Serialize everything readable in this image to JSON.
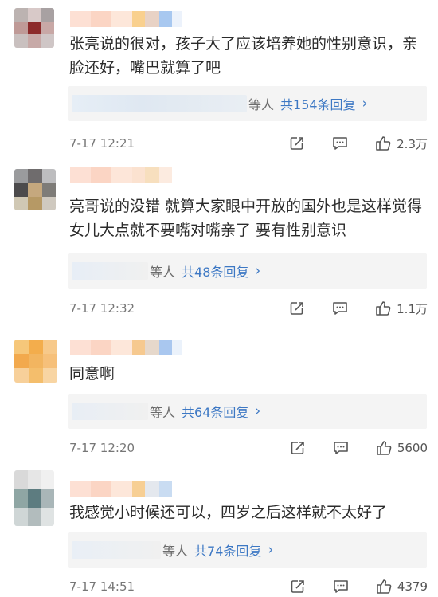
{
  "comments": [
    {
      "text": "张亮说的很对，孩子大了应该培养她的性别意识，亲脸还好，嘴巴就算了吧",
      "reply_suffix": "等人",
      "reply_count": "共154条回复",
      "timestamp": "7-17 12:21",
      "likes": "2.3万",
      "avatar_colors": [
        "#bcb3b1",
        "#d8c9c8",
        "#a8a1a2",
        "#bf9a97",
        "#8c2a2a",
        "#c8a8a6",
        "#c9c0bf",
        "#c7a9a7",
        "#cfc6c6"
      ],
      "name_colors": [
        "#fde0d4",
        "#fbd5c4",
        "#fde7da",
        "#f9d08e",
        "#e8d2c5",
        "#a8c8f0",
        "#ecf2fb"
      ]
    },
    {
      "text": "亮哥说的没错 就算大家眼中开放的国外也是这样觉得 女儿大点就不要嘴对嘴亲了 要有性别意识",
      "reply_suffix": "等人",
      "reply_count": "共48条回复",
      "timestamp": "7-17 12:32",
      "likes": "1.1万",
      "avatar_colors": [
        "#9a9b9d",
        "#6f6c6d",
        "#bdbdbf",
        "#4c4b4c",
        "#c5a87e",
        "#7e7c78",
        "#d0c8b4",
        "#b69965",
        "#cfc9bf"
      ],
      "name_colors": [
        "#fde0d4",
        "#fbd5c4",
        "#fde6d9",
        "#fbe2d0",
        "#f7dfbe",
        "#fcebe0"
      ]
    },
    {
      "text": "同意啊",
      "reply_suffix": "等人",
      "reply_count": "共64条回复",
      "timestamp": "7-17 12:20",
      "likes": "5600",
      "avatar_colors": [
        "#f6c77a",
        "#f3ad4c",
        "#f7c98a",
        "#f2a94d",
        "#f2b560",
        "#f6c07a",
        "#f7d09a",
        "#f4be6c",
        "#f8d5a3"
      ],
      "name_colors": [
        "#fde0d4",
        "#fbd5c4",
        "#fde7da",
        "#f6c98f",
        "#e6d8cb",
        "#a9c7ef",
        "#ebf2fb"
      ]
    },
    {
      "text": "我感觉小时候还可以，四岁之后这样就不太好了",
      "reply_suffix": "等人",
      "reply_count": "共74条回复",
      "timestamp": "7-17 14:51",
      "likes": "4379",
      "avatar_colors": [
        "#d9d9d9",
        "#e6e6e6",
        "#f0f0f0",
        "#8fa6a4",
        "#5d7c80",
        "#a9b6b8",
        "#cfd6d6",
        "#b2bcbd",
        "#dfe3e3"
      ],
      "name_colors": [
        "#fde0d4",
        "#fbd5c4",
        "#fde7da",
        "#f7cf94",
        "#e4e8ee",
        "#c9dcf2"
      ]
    }
  ],
  "icons": {
    "share": "share-icon",
    "comment": "comment-icon",
    "like": "thumbs-up-icon"
  }
}
